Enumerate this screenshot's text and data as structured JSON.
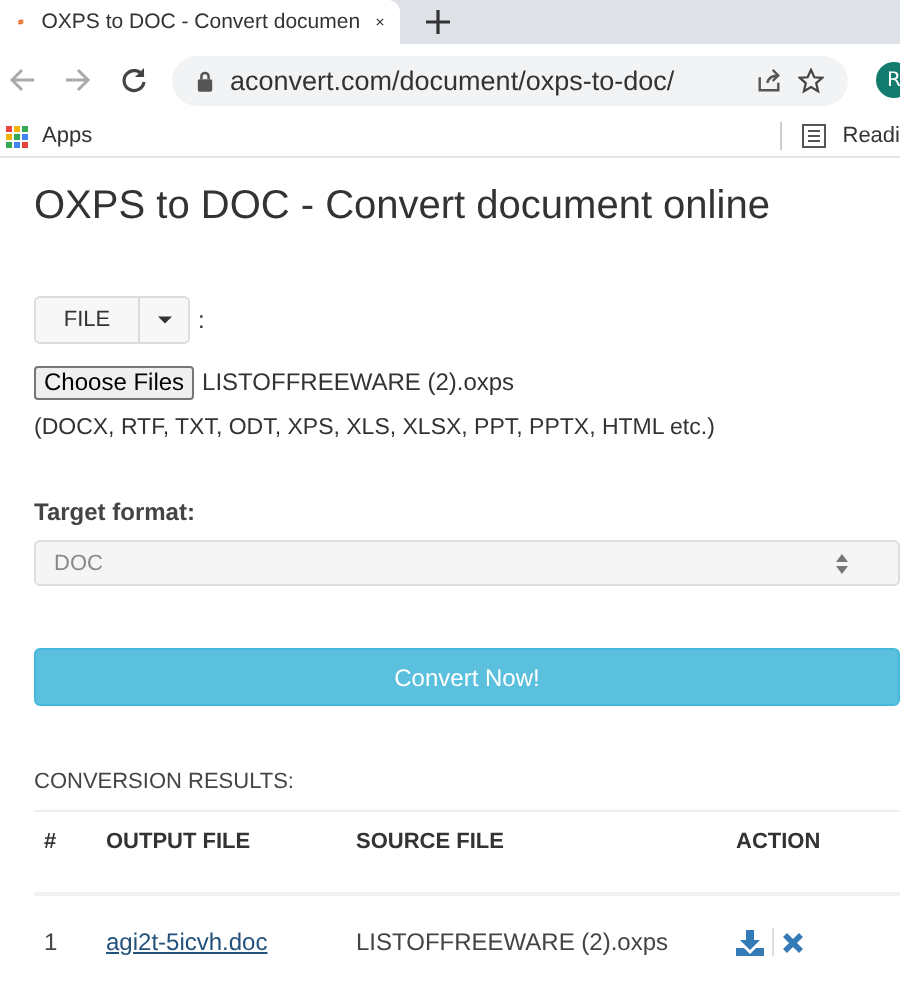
{
  "browser": {
    "tab_title": "OXPS to DOC - Convert documen",
    "address": "aconvert.com/document/oxps-to-doc/",
    "avatar_letter": "R",
    "bookmarks": [
      "Apps"
    ],
    "reading_list": "Readi"
  },
  "page": {
    "title": "OXPS to DOC - Convert document online",
    "file_source": {
      "label": "FILE",
      "colon": ":"
    },
    "file_input": {
      "button": "Choose Files",
      "value": "LISTOFFREEWARE (2).oxps"
    },
    "formats_hint": "(DOCX, RTF, TXT, ODT, XPS, XLS, XLSX, PPT, PPTX, HTML etc.)",
    "target_format": {
      "label": "Target format:",
      "value": "DOC"
    },
    "convert_button": "Convert Now!",
    "results": {
      "heading": "CONVERSION RESULTS:",
      "columns": [
        "#",
        "OUTPUT FILE",
        "SOURCE FILE",
        "ACTION"
      ],
      "rows": [
        {
          "number": "1",
          "output_file": "agi2t-5icvh.doc",
          "source_file": "LISTOFFREEWARE (2).oxps"
        }
      ]
    }
  }
}
